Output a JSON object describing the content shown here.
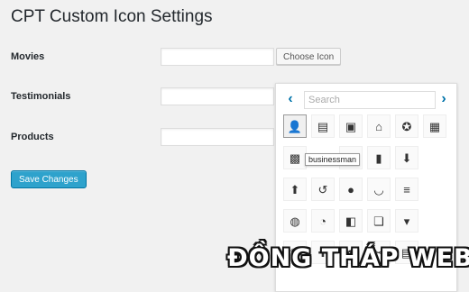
{
  "page": {
    "title": "CPT Custom Icon Settings"
  },
  "rows": [
    {
      "label": "Movies",
      "value": ""
    },
    {
      "label": "Testimonials",
      "value": ""
    },
    {
      "label": "Products",
      "value": ""
    }
  ],
  "choose_button_label": "Choose Icon",
  "save_button_label": "Save Changes",
  "picker": {
    "search_placeholder": "Search",
    "prev_glyph": "‹",
    "next_glyph": "›",
    "tooltip": "businessman",
    "icons": [
      {
        "name": "businessman-icon",
        "glyph": "👤"
      },
      {
        "name": "id-card-icon",
        "glyph": "▤"
      },
      {
        "name": "id-badge-icon",
        "glyph": "▣"
      },
      {
        "name": "store-icon",
        "glyph": "⌂"
      },
      {
        "name": "award-icon",
        "glyph": "✪"
      },
      {
        "name": "screen-options-icon",
        "glyph": "▦"
      },
      {
        "name": "qr-code-icon",
        "glyph": "▩"
      },
      {
        "name": "hidden-icon",
        "glyph": ""
      },
      {
        "name": "book-icon",
        "glyph": "▮"
      },
      {
        "name": "book-alt-icon",
        "glyph": "▮"
      },
      {
        "name": "download-icon",
        "glyph": "⬇"
      },
      {
        "name": "blank-icon",
        "glyph": ""
      },
      {
        "name": "upload-icon",
        "glyph": "⬆"
      },
      {
        "name": "backup-icon",
        "glyph": "↺"
      },
      {
        "name": "lightbulb-icon",
        "glyph": "●"
      },
      {
        "name": "smiley-icon",
        "glyph": "◡"
      },
      {
        "name": "menu-icon",
        "glyph": "≡"
      },
      {
        "name": "blank-icon-2",
        "glyph": ""
      },
      {
        "name": "globe-icon",
        "glyph": "◍"
      },
      {
        "name": "dashboard-icon",
        "glyph": "◔"
      },
      {
        "name": "media-icon",
        "glyph": "◧"
      },
      {
        "name": "pages-icon",
        "glyph": "❏"
      },
      {
        "name": "comment-icon",
        "glyph": "▾"
      },
      {
        "name": "blank-icon-3",
        "glyph": ""
      },
      {
        "name": "brush-icon",
        "glyph": "✎"
      },
      {
        "name": "plugin-icon",
        "glyph": "✚"
      },
      {
        "name": "users-icon",
        "glyph": "☻"
      },
      {
        "name": "tools-icon",
        "glyph": "✂"
      },
      {
        "name": "settings-icon",
        "glyph": "▤"
      },
      {
        "name": "blank-icon-4",
        "glyph": ""
      }
    ]
  },
  "watermark": "ĐỒNG THÁP WEB"
}
